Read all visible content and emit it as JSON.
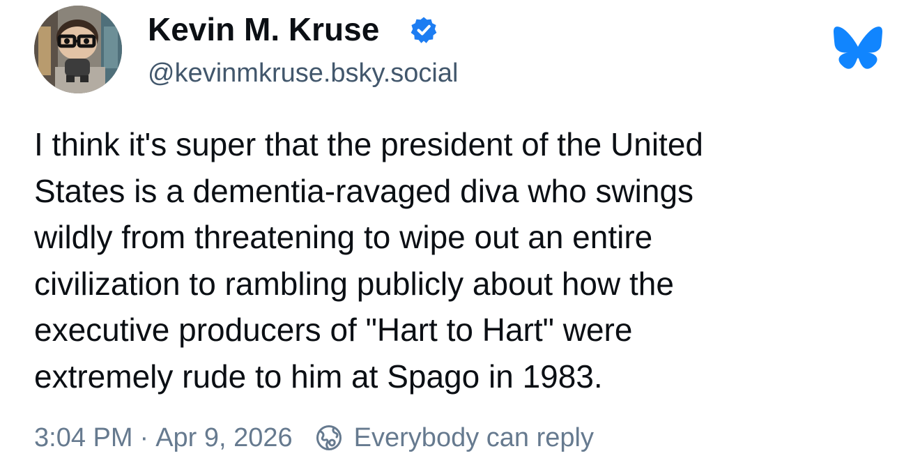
{
  "author": {
    "display_name": "Kevin M. Kruse",
    "handle": "@kevinmkruse.bsky.social",
    "verified": true,
    "verified_icon": "verified-check-icon",
    "avatar": "funko-figure-avatar"
  },
  "brand": {
    "logo_icon": "bluesky-butterfly-icon",
    "accent_color": "#1185fe"
  },
  "post": {
    "lines": [
      "I think it's super that the president of the United",
      "States is a dementia-ravaged diva who swings",
      "wildly from threatening to wipe out an entire",
      "civilization to rambling publicly about how the",
      "executive producers of \"Hart to Hart\" were",
      "extremely rude to him at Spago in 1983."
    ],
    "time": "3:04 PM",
    "separator": "·",
    "date": "Apr 9, 2026",
    "reply_setting": "Everybody can reply",
    "reply_setting_icon": "globe-icon"
  }
}
